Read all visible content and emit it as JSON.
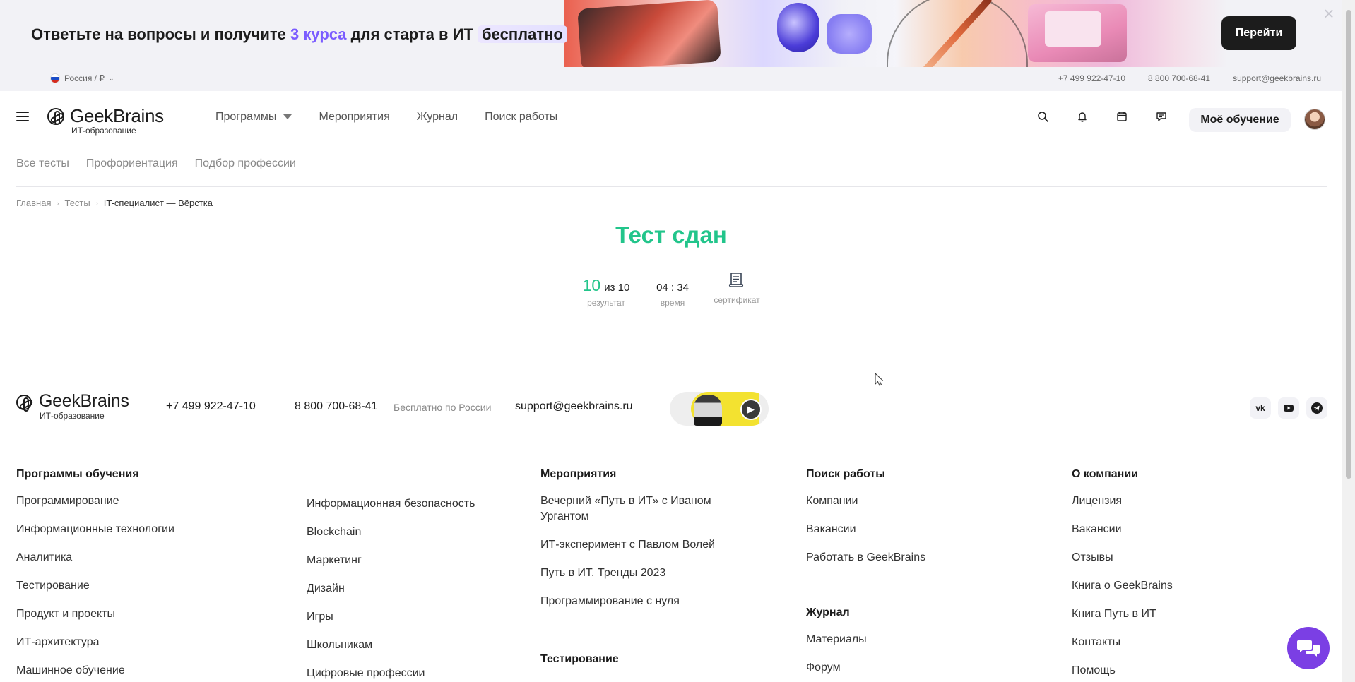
{
  "promo": {
    "text_before": "Ответьте на вопросы и получите ",
    "text_accent": "3 курса",
    "text_mid": " для старта в ИТ ",
    "text_free": "бесплатно",
    "button_label": "Перейти",
    "close_icon": "×"
  },
  "topbar": {
    "region_label": "Россия / ₽",
    "phone1": "+7 499 922-47-10",
    "phone2": "8 800 700-68-41",
    "email": "support@geekbrains.ru"
  },
  "header": {
    "logo_name": "GeekBrains",
    "logo_sub": "ИТ-образование",
    "nav": [
      "Программы",
      "Мероприятия",
      "Журнал",
      "Поиск работы"
    ],
    "icons": [
      "search-icon",
      "bell-icon",
      "calendar-icon",
      "chat-icon"
    ],
    "my_learning": "Моё обучение"
  },
  "subnav": [
    "Все тесты",
    "Профориентация",
    "Подбор профессии"
  ],
  "breadcrumb": {
    "home": "Главная",
    "tests": "Тесты",
    "current": "IT-специалист — Вёрстка"
  },
  "result": {
    "title": "Тест сдан",
    "score": "10",
    "score_total": "из 10",
    "score_label": "результат",
    "time": "04 : 34",
    "time_label": "время",
    "cert_label": "сертификат"
  },
  "footer": {
    "logo_name": "GeekBrains",
    "logo_sub": "ИТ-образование",
    "phone1": "+7 499 922-47-10",
    "phone2": "8 800 700-68-41",
    "phone2_note": "Бесплатно по России",
    "email": "support@geekbrains.ru",
    "socials": [
      "vk-icon",
      "youtube-icon",
      "telegram-icon"
    ],
    "col_programs": {
      "title": "Программы обучения",
      "left": [
        "Программирование",
        "Информационные технологии",
        "Аналитика",
        "Тестирование",
        "Продукт и проекты",
        "ИТ-архитектура",
        "Машинное обучение"
      ],
      "right": [
        "Информационная безопасность",
        "Blockchain",
        "Маркетинг",
        "Дизайн",
        "Игры",
        "Школьникам",
        "Цифровые профессии"
      ]
    },
    "col_events": {
      "title": "Мероприятия",
      "links": [
        "Вечерний «Путь в ИТ» с Иваном Ургантом",
        "ИТ-эксперимент с Павлом Волей",
        "Путь в ИТ. Тренды 2023",
        "Программирование с нуля"
      ],
      "title2": "Тестирование"
    },
    "col_jobs": {
      "title": "Поиск работы",
      "links": [
        "Компании",
        "Вакансии",
        "Работать в GeekBrains"
      ],
      "title2": "Журнал",
      "links2": [
        "Материалы",
        "Форум"
      ]
    },
    "col_company": {
      "title": "О компании",
      "links": [
        "Лицензия",
        "Вакансии",
        "Отзывы",
        "Книга о GeekBrains",
        "Книга Путь в ИТ",
        "Контакты",
        "Помощь"
      ]
    }
  },
  "colors": {
    "accent_green": "#22c58b",
    "accent_purple": "#7b5cff",
    "chat_button": "#7b3fe4"
  }
}
